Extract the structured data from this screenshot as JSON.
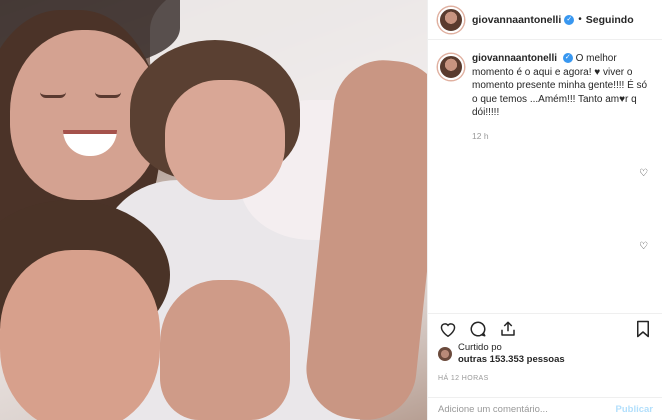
{
  "header": {
    "username": "giovannaantonelli",
    "follow_label": "Seguindo",
    "separator": "•"
  },
  "caption": {
    "username": "giovannaantonelli",
    "text": "O melhor momento é o aqui e agora! ♥ viver o momento presente minha gente!!!! É só o que temos ...Amém!!! Tanto am♥r q dói!!!!!",
    "time": "12 h"
  },
  "likes": {
    "prefix": "Curtido po",
    "line2": "outras 153.353 pessoas"
  },
  "posted_ago": "HÁ 12 HORAS",
  "comment": {
    "placeholder": "Adicione um comentário...",
    "publish_label": "Publicar"
  }
}
